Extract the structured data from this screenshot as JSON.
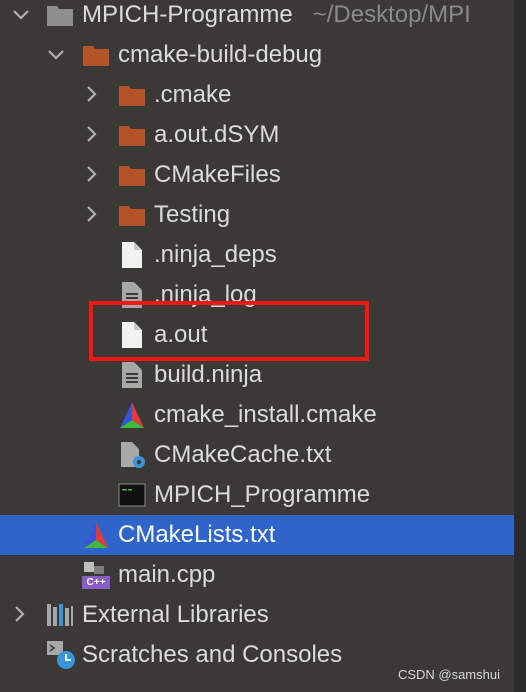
{
  "tree": {
    "root": {
      "label": "MPICH-Programme",
      "path": "~/Desktop/MPI"
    },
    "build_dir": "cmake-build-debug",
    "folders": [
      ".cmake",
      "a.out.dSYM",
      "CMakeFiles",
      "Testing"
    ],
    "files": [
      ".ninja_deps",
      ".ninja_log",
      "a.out",
      "build.ninja",
      "cmake_install.cmake",
      "CMakeCache.txt",
      "MPICH_Programme"
    ],
    "cmakelists": "CMakeLists.txt",
    "main_cpp": "main.cpp",
    "external_libraries": "External Libraries",
    "scratches": "Scratches and Consoles",
    "cpp_badge": "C++"
  },
  "watermark": "CSDN @samshui",
  "colors": {
    "panel_bg": "#3b3935",
    "selection": "#2f65ca",
    "folder": "#b5532a",
    "highlight_box": "#ff1515"
  }
}
